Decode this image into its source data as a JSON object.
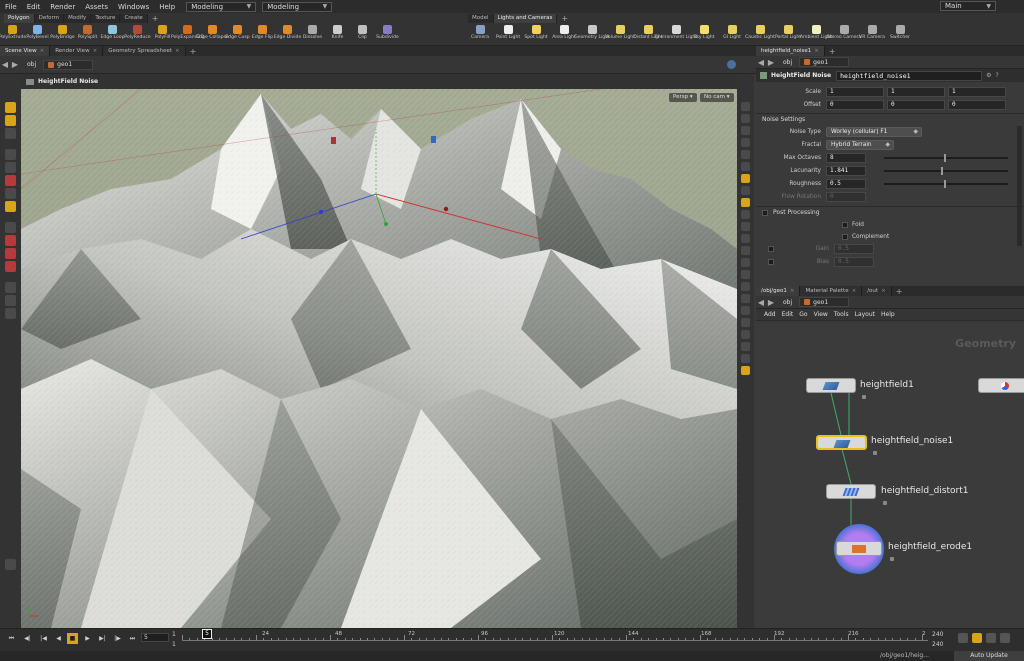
{
  "menubar": {
    "items": [
      "File",
      "Edit",
      "Render",
      "Assets",
      "Windows",
      "Help"
    ],
    "desktop1": "Modeling",
    "desktop2": "Modeling",
    "main": "Main"
  },
  "shelf": {
    "tabs_left": [
      "Polygon",
      "Deform",
      "Modify",
      "Texture",
      "Create"
    ],
    "tabs_right": [
      "Model",
      "Lights and Cameras"
    ],
    "tools_left": [
      "PolyExtrude",
      "PolyBevel",
      "PolyBridge",
      "PolySplit",
      "Edge Loop",
      "PolyReduce",
      "PolyFill",
      "PolyExpand2D",
      "Edge Collapse",
      "Edge Cusp",
      "Edge Flip",
      "Edge Divide",
      "Dissolve",
      "Knife",
      "Clip",
      "Subdivide"
    ],
    "tools_right": [
      "Camera",
      "Point Light",
      "Spot Light",
      "Area Light",
      "Geometry Light",
      "Volume Light",
      "Distant Light",
      "Environment Light",
      "Sky Light",
      "GI Light",
      "Caustic Light",
      "Portal Light",
      "Ambient Light",
      "Stereo Camera",
      "VR Camera",
      "Switcher"
    ]
  },
  "viewer": {
    "tabs": [
      "Scene View",
      "Render View",
      "Geometry Spreadsheet"
    ],
    "path_obj": "obj",
    "path_geo": "geo1",
    "title": "HeightField Noise",
    "persp": "Persp",
    "cam": "No cam"
  },
  "params": {
    "tab": "heightfield_noise1",
    "path_obj": "obj",
    "path_geo": "geo1",
    "node_type": "HeightField Noise",
    "node_name": "heightfield_noise1",
    "scale_label": "Scale",
    "scale": [
      "1",
      "1",
      "1"
    ],
    "offset_label": "Offset",
    "offset": [
      "0",
      "0",
      "0"
    ],
    "noise_settings": "Noise Settings",
    "noise_type_label": "Noise Type",
    "noise_type": "Worley (cellular) F1",
    "fractal_label": "Fractal",
    "fractal": "Hybrid Terrain",
    "max_octaves_label": "Max Octaves",
    "max_octaves": "8",
    "lacunarity_label": "Lacunarity",
    "lacunarity": "1.841",
    "roughness_label": "Roughness",
    "roughness": "0.5",
    "flow_rotation_label": "Flow Rotation",
    "flow_rotation": "0",
    "post_processing": "Post Processing",
    "fold_label": "Fold",
    "complement_label": "Complement",
    "gain_label": "Gain",
    "gain": "0.5",
    "bias_label": "Bias",
    "bias": "0.5"
  },
  "network": {
    "tabs": [
      "/obj/geo1",
      "Material Palette",
      "/out"
    ],
    "path_obj": "obj",
    "path_geo": "geo1",
    "menu": [
      "Add",
      "Edit",
      "Go",
      "View",
      "Tools",
      "Layout",
      "Help"
    ],
    "context": "Geometry",
    "nodes": [
      "heightfield1",
      "heightfield_noise1",
      "heightfield_distort1",
      "heightfield_erode1"
    ]
  },
  "timeline": {
    "frame": "5",
    "start": "1",
    "start2": "1",
    "current": "5",
    "ticks": [
      "24",
      "48",
      "72",
      "96",
      "120",
      "144",
      "168",
      "192",
      "216"
    ],
    "end_marker": "2",
    "end": "240",
    "end2": "240"
  },
  "status": {
    "path": "/obj/geo1/heig...",
    "auto_update": "Auto Update"
  }
}
